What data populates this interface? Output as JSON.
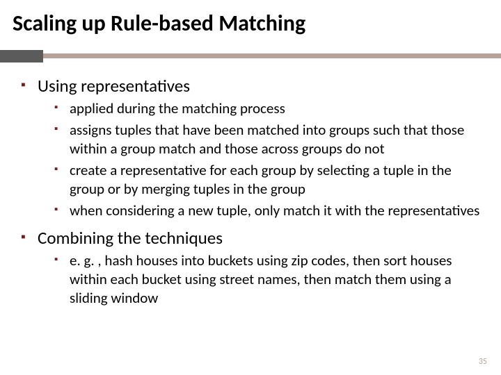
{
  "title": "Scaling up Rule-based Matching",
  "bullets": [
    {
      "text": "Using representatives",
      "children": [
        "applied during the matching process",
        "assigns tuples that have been matched into groups such that those within a group match and those across groups do not",
        "create a representative for each group by selecting a tuple in the group or by merging tuples in the group",
        "when considering a new tuple, only match it with the representatives"
      ]
    },
    {
      "text": "Combining the techniques",
      "children": [
        "e. g. , hash houses into buckets using zip codes, then sort houses within each bucket using street names, then match them using a sliding window"
      ]
    }
  ],
  "page_number": "35"
}
